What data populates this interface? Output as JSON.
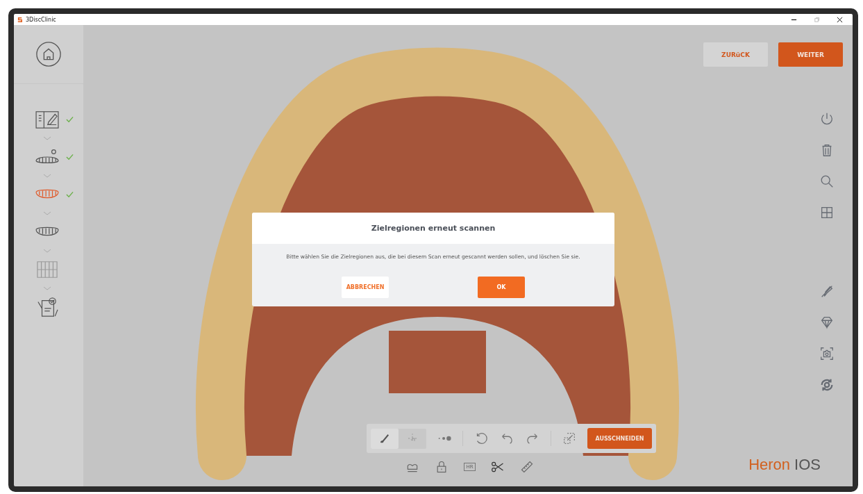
{
  "window": {
    "title": "3DiscClinic"
  },
  "steps": [
    {
      "kind": "form",
      "done": true,
      "selected": false
    },
    {
      "kind": "upper-jaw",
      "done": true,
      "selected": false
    },
    {
      "kind": "lower-jaw",
      "done": true,
      "selected": true
    },
    {
      "kind": "lower-jaw",
      "done": false,
      "selected": false
    },
    {
      "kind": "bite",
      "done": false,
      "selected": false
    },
    {
      "kind": "report",
      "done": false,
      "selected": false
    }
  ],
  "nav_buttons": [
    {
      "label": "ZURüCK",
      "kind": "secondary"
    },
    {
      "label": "WEITER",
      "kind": "primary"
    }
  ],
  "right_tools": [
    {
      "kind": "power"
    },
    {
      "kind": "trash"
    },
    {
      "kind": "search"
    },
    {
      "kind": "grid"
    },
    {
      "kind": "gap"
    },
    {
      "kind": "no-pen"
    },
    {
      "kind": "diamond"
    },
    {
      "kind": "camera"
    },
    {
      "kind": "sync"
    }
  ],
  "dialog": {
    "title": "Zielregionen erneut scannen",
    "message": "Bitte wählen Sie die Zielregionen aus, die bei diesem Scan erneut gescannt werden sollen, und löschen Sie sie.",
    "cancel": "ABBRECHEN",
    "ok": "OK"
  },
  "edit_toolbar": {
    "tools": [
      {
        "kind": "brush",
        "selected": true
      },
      {
        "kind": "gesture",
        "selected": false
      }
    ],
    "actions": [
      {
        "kind": "dots"
      },
      {
        "kind": "rotate"
      },
      {
        "kind": "undo"
      },
      {
        "kind": "redo"
      },
      {
        "kind": "select"
      }
    ],
    "cut_button": "AUSSCHNEIDEN"
  },
  "bottom_tools": [
    {
      "kind": "arch",
      "selected": false
    },
    {
      "kind": "lock",
      "selected": false
    },
    {
      "kind": "hr",
      "label": "HR",
      "selected": false
    },
    {
      "kind": "scissors",
      "selected": true
    },
    {
      "kind": "ruler",
      "selected": false
    }
  ],
  "logo": {
    "brand": "Heron",
    "product": "IOS"
  }
}
